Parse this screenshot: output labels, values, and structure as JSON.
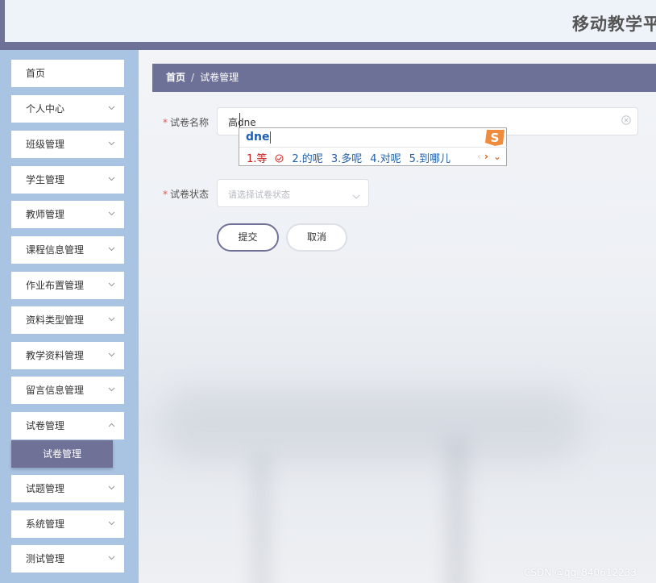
{
  "app": {
    "title": "移动教学平"
  },
  "sidebar": {
    "items": [
      {
        "label": "首页",
        "has_arrow": false
      },
      {
        "label": "个人中心",
        "has_arrow": true
      },
      {
        "label": "班级管理",
        "has_arrow": true
      },
      {
        "label": "学生管理",
        "has_arrow": true
      },
      {
        "label": "教师管理",
        "has_arrow": true
      },
      {
        "label": "课程信息管理",
        "has_arrow": true
      },
      {
        "label": "作业布置管理",
        "has_arrow": true
      },
      {
        "label": "资料类型管理",
        "has_arrow": true
      },
      {
        "label": "教学资料管理",
        "has_arrow": true
      },
      {
        "label": "留言信息管理",
        "has_arrow": true
      },
      {
        "label": "试卷管理",
        "has_arrow": true
      },
      {
        "label": "试题管理",
        "has_arrow": true
      },
      {
        "label": "系统管理",
        "has_arrow": true
      },
      {
        "label": "测试管理",
        "has_arrow": true
      }
    ],
    "active_submenu": "试卷管理"
  },
  "breadcrumb": {
    "home": "首页",
    "separator": "/",
    "current": "试卷管理"
  },
  "form": {
    "name_label": "试卷名称",
    "name_value": "高dne",
    "status_label": "试卷状态",
    "status_placeholder": "请选择试卷状态",
    "submit_label": "提交",
    "cancel_label": "取消"
  },
  "ime": {
    "pinyin": "dne",
    "candidates": [
      "1.等",
      "2.的呢",
      "3.多呢",
      "4.对呢",
      "5.到哪儿"
    ]
  },
  "watermark": "CSDN @qq_840612233",
  "colors": {
    "accent": "#6e7197",
    "sidebar_bg": "#a9c4e2",
    "required": "#e0554d",
    "ime_text": "#1f5faa"
  }
}
